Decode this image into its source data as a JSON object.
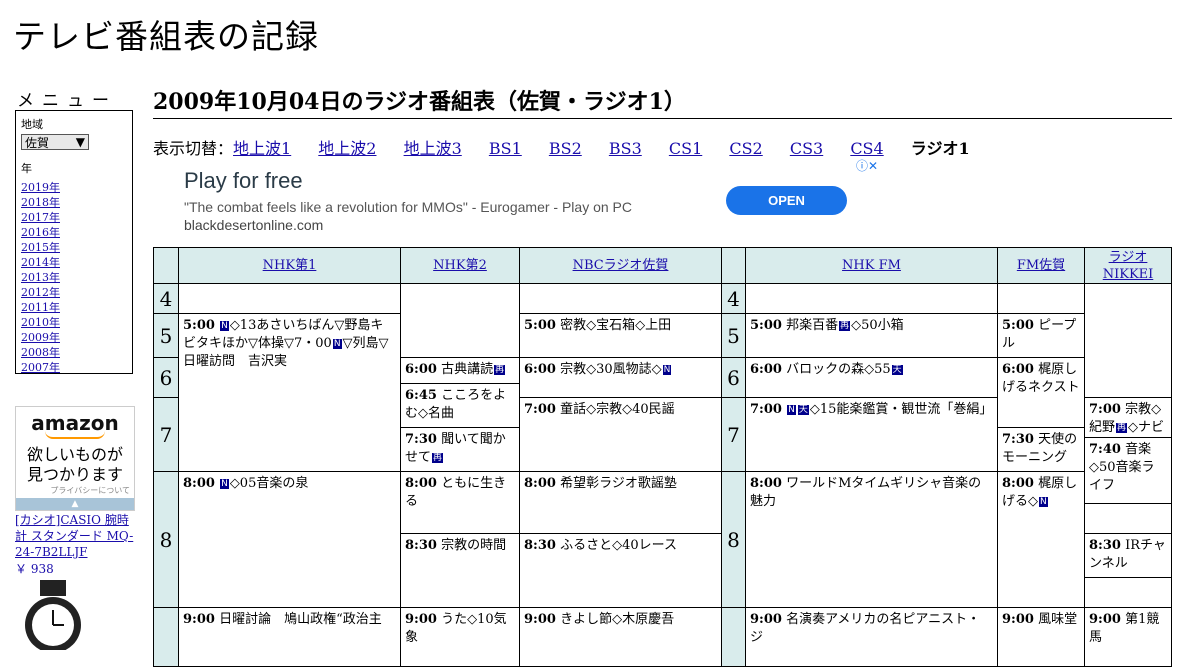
{
  "site": {
    "title": "テレビ番組表の記録"
  },
  "menu": {
    "heading": "メニュー",
    "region_label": "地域",
    "region_value": "佐賀",
    "year_label": "年",
    "years": [
      "2019年",
      "2018年",
      "2017年",
      "2016年",
      "2015年",
      "2014年",
      "2013年",
      "2012年",
      "2011年",
      "2010年",
      "2009年",
      "2008年",
      "2007年"
    ]
  },
  "amazon": {
    "logo": "amazon",
    "text_line1": "欲しいものが",
    "text_line2": "見つかります",
    "privacy": "プライバシーについて",
    "product": "[カシオ]CASIO 腕時計 スタンダード MQ-24-7B2LLJF",
    "price": "￥ 938"
  },
  "page": {
    "title": "2009年10月04日のラジオ番組表（佐賀・ラジオ1）"
  },
  "switcher": {
    "label": "表示切替：",
    "links": [
      "地上波1",
      "地上波2",
      "地上波3",
      "BS1",
      "BS2",
      "BS3",
      "CS1",
      "CS2",
      "CS3",
      "CS4"
    ],
    "current": "ラジオ1"
  },
  "ad": {
    "headline": "Play for free",
    "description": "\"The combat feels like a revolution for MMOs\" - Eurogamer - Play on PC",
    "domain": "blackdesertonline.com",
    "cta": "OPEN",
    "choices_icon": "info-close-icon"
  },
  "channels": [
    "NHK第1",
    "NHK第2",
    "NBCラジオ佐賀",
    "NHK FM",
    "FM佐賀",
    "ラジオNIKKEI"
  ],
  "hours": [
    "4",
    "5",
    "6",
    "7",
    "8"
  ],
  "programs": {
    "nhk1_0500": {
      "time": "5:00",
      "badge1": "N",
      "text": "◇13あさいちばん▽野島キビタキほか▽体操▽7・00",
      "badge2": "N",
      "text2": "▽列島▽日曜訪問　吉沢実"
    },
    "nhk1_0800": {
      "time": "8:00",
      "badge1": "N",
      "text": "◇05音楽の泉"
    },
    "nhk1_0900": {
      "time": "9:00",
      "text": "日曜討論　鳩山政権“政治主"
    },
    "nhk2_0600": {
      "time": "6:00",
      "text": "古典講読",
      "badge1": "再"
    },
    "nhk2_0645": {
      "time": "6:45",
      "text": "こころをよむ◇名曲"
    },
    "nhk2_0730": {
      "time": "7:30",
      "text": "聞いて聞かせて",
      "badge1": "再"
    },
    "nhk2_0800": {
      "time": "8:00",
      "text": "ともに生きる"
    },
    "nhk2_0830": {
      "time": "8:30",
      "text": "宗教の時間"
    },
    "nhk2_0900": {
      "time": "9:00",
      "text": "うた◇10気象"
    },
    "nbc_0500": {
      "time": "5:00",
      "text": "密教◇宝石箱◇上田"
    },
    "nbc_0600": {
      "time": "6:00",
      "text": "宗教◇30風物誌◇",
      "badge1": "N"
    },
    "nbc_0700": {
      "time": "7:00",
      "text": "童話◇宗教◇40民謡"
    },
    "nbc_0800": {
      "time": "8:00",
      "text": "希望彰ラジオ歌謡塾"
    },
    "nbc_0830": {
      "time": "8:30",
      "text": "ふるさと◇40レース"
    },
    "nbc_0900": {
      "time": "9:00",
      "text": "きよし節◇木原慶吾"
    },
    "fm_0500": {
      "time": "5:00",
      "text": "邦楽百番",
      "badge1": "再",
      "text2": "◇50小箱"
    },
    "fm_0600": {
      "time": "6:00",
      "text": "バロックの森◇55",
      "badge1": "天"
    },
    "fm_0700": {
      "time": "7:00",
      "badge1": "N",
      "badge2": "天",
      "text": "◇15能楽鑑賞・観世流「巻絹」"
    },
    "fm_0800": {
      "time": "8:00",
      "text": "ワールドMタイムギリシャ音楽の魅力"
    },
    "fm_0900": {
      "time": "9:00",
      "text": "名演奏アメリカの名ピアニスト・ジ"
    },
    "fmsaga_0500": {
      "time": "5:00",
      "text": "ピープル"
    },
    "fmsaga_0600": {
      "time": "6:00",
      "text": "梶原しげるネクスト"
    },
    "fmsaga_0730": {
      "time": "7:30",
      "text": "天使のモーニング"
    },
    "fmsaga_0800": {
      "time": "8:00",
      "text": "梶原しげる◇",
      "badge1": "N"
    },
    "fmsaga_0900": {
      "time": "9:00",
      "text": "風味堂"
    },
    "nikkei_0700": {
      "time": "7:00",
      "text": "宗教◇紀野",
      "badge1": "再",
      "text2": "◇ナビ"
    },
    "nikkei_0740": {
      "time": "7:40",
      "text": "音楽◇50音楽ライフ"
    },
    "nikkei_0830": {
      "time": "8:30",
      "text": "IRチャンネル"
    },
    "nikkei_0900": {
      "time": "9:00",
      "text": "第1競馬"
    }
  }
}
